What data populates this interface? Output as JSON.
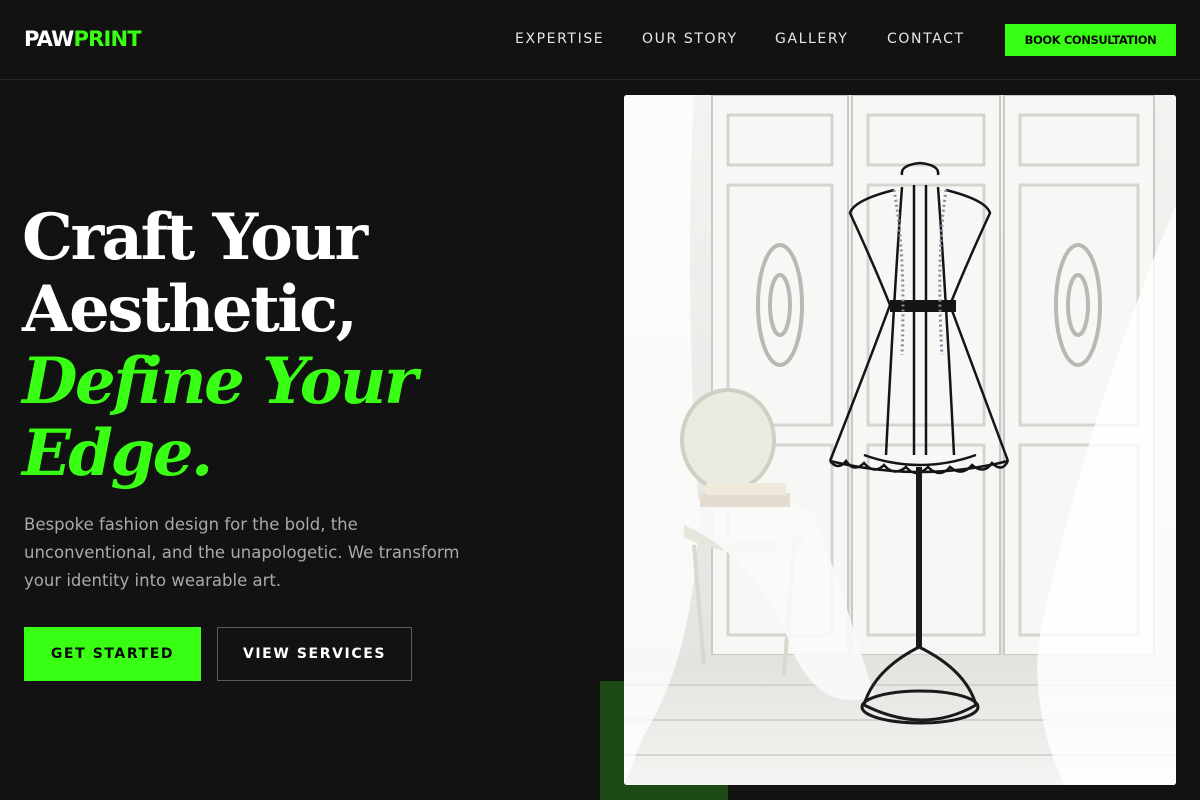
{
  "brand": {
    "logo_part1": "PAW",
    "logo_part2": "PRINT"
  },
  "nav": {
    "items": [
      {
        "label": "EXPERTISE"
      },
      {
        "label": "OUR STORY"
      },
      {
        "label": "GALLERY"
      },
      {
        "label": "CONTACT"
      }
    ],
    "cta_label": "BOOK CONSULTATION"
  },
  "hero": {
    "title_line1": "Craft Your",
    "title_line2": "Aesthetic,",
    "title_line3": "Define Your",
    "title_line4": "Edge.",
    "description": "Bespoke fashion design for the bold, the unconventional, and the unapologetic. We transform your identity into wearable art.",
    "primary_button": "GET STARTED",
    "secondary_button": "VIEW SERVICES",
    "image_subject": "dress-form-mannequin-photo"
  },
  "colors": {
    "background": "#121212",
    "accent": "#39ff14",
    "accent_dark": "#1d4a14",
    "text_muted": "#a9a9ad"
  }
}
